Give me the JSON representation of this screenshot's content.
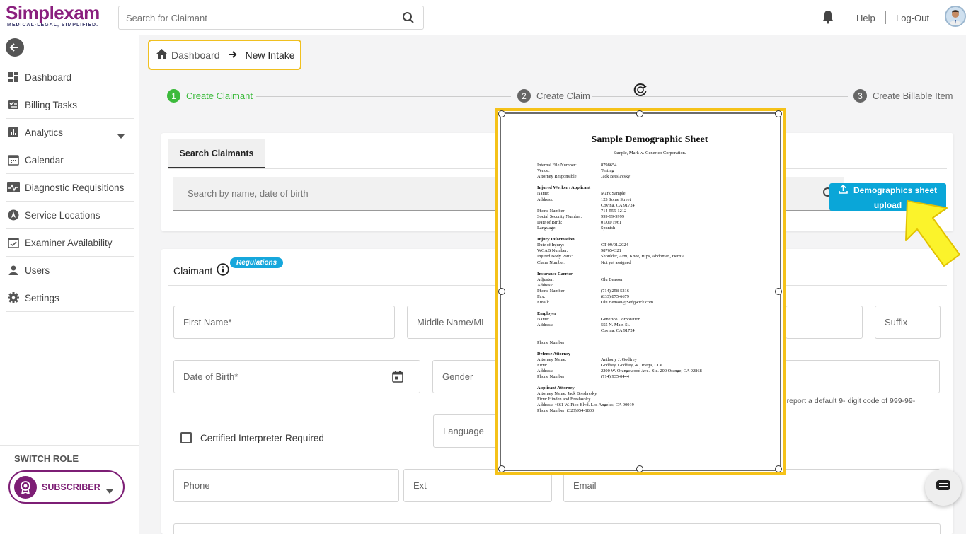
{
  "header": {
    "logo_main": "Simplexam",
    "logo_tagline": "MEDICAL-LEGAL, SIMPLIFIED.",
    "search_placeholder": "Search for Claimant",
    "help": "Help",
    "logout": "Log-Out"
  },
  "sidebar": {
    "items": [
      {
        "label": "Dashboard",
        "icon": "dashboard-icon"
      },
      {
        "label": "Billing Tasks",
        "icon": "billing-icon"
      },
      {
        "label": "Analytics",
        "icon": "analytics-icon"
      },
      {
        "label": "Calendar",
        "icon": "calendar-icon"
      },
      {
        "label": "Diagnostic Requisitions",
        "icon": "diagnostic-icon"
      },
      {
        "label": "Service Locations",
        "icon": "location-icon"
      },
      {
        "label": "Examiner Availability",
        "icon": "availability-icon"
      },
      {
        "label": "Users",
        "icon": "user-icon"
      },
      {
        "label": "Settings",
        "icon": "gear-icon"
      }
    ],
    "switch_role_label": "SWITCH ROLE",
    "role": "SUBSCRIBER"
  },
  "breadcrumb": {
    "home": "Dashboard",
    "current": "New Intake"
  },
  "stepper": {
    "steps": [
      {
        "num": "1",
        "label": "Create Claimant",
        "active": true
      },
      {
        "num": "2",
        "label": "Create Claim",
        "active": false
      },
      {
        "num": "3",
        "label": "Create Billable Item",
        "active": false
      }
    ]
  },
  "search_card": {
    "tab": "Search Claimants",
    "placeholder": "Search by name, date of birth",
    "upload_button_line1": "Demographics sheet",
    "upload_button_line2": "upload"
  },
  "claimant_card": {
    "title": "Claimant",
    "badge": "Regulations",
    "first_name": "First Name*",
    "middle_name": "Middle Name/MI",
    "suffix": "Suffix",
    "dob": "Date of Birth*",
    "gender": "Gender",
    "ssn_hint": "e, report a default 9- digit code of 999-99-",
    "interpreter": "Certified Interpreter Required",
    "language": "Language",
    "phone": "Phone",
    "ext": "Ext",
    "email": "Email"
  },
  "document": {
    "title": "Sample Demographic Sheet",
    "subtitle": "Sample, Mark .v. Generico Corporation.",
    "sections": [
      {
        "heading": "",
        "rows": [
          [
            "Internal File Number:",
            "8798654"
          ],
          [
            "Venue:",
            "Testing"
          ],
          [
            "Attorney Responsible:",
            "Jack Breslavsky"
          ]
        ]
      },
      {
        "heading": "Injured Worker / Applicant",
        "rows": [
          [
            "Name:",
            "Mark Sample"
          ],
          [
            "Address:",
            "123 Some Street"
          ],
          [
            "",
            "Covina, CA 91724"
          ],
          [
            "Phone Number:",
            "714-555-1212"
          ],
          [
            "Social Security Number:",
            "999-99-9999"
          ],
          [
            "Date of Birth:",
            "01/01/1961"
          ],
          [
            "Language:",
            "Spanish"
          ]
        ]
      },
      {
        "heading": "Injury Information",
        "rows": [
          [
            "Date of Injury:",
            "CT 09/01/2024"
          ],
          [
            "WCAB Number:",
            "987654321"
          ],
          [
            "Injured Body Parts:",
            "Shoulder, Arm, Knee, Hips, Abdomen, Hernia"
          ],
          [
            "Claim Number:",
            "Not yet assigned"
          ]
        ]
      },
      {
        "heading": "Insurance Carrier",
        "rows": [
          [
            "Adjuster:",
            "Olu Benson"
          ],
          [
            "Address:",
            ""
          ],
          [
            "Phone Number:",
            "(714) 258-5216"
          ],
          [
            "Fax:",
            "(833) 875-6679"
          ],
          [
            "Email:",
            "Olu.Benson@Sedgwick.com"
          ]
        ]
      },
      {
        "heading": "Employer",
        "rows": [
          [
            "Name:",
            "Generico Corporation"
          ],
          [
            "Address:",
            "555 N. Main St."
          ],
          [
            "",
            "Covina, CA 91724"
          ],
          [
            "",
            ""
          ],
          [
            "Phone Number:",
            ""
          ]
        ]
      },
      {
        "heading": "Defense Attorney",
        "rows": [
          [
            "Attorney Name:",
            "Anthony J. Godfrey"
          ],
          [
            "Firm:",
            "Godfrey, Godfrey,  & Ortega, LLP"
          ],
          [
            "Address:",
            "2200 W. Orangewood Ave., Ste. 200 Orange, CA 92868"
          ],
          [
            "Phone Number:",
            "(714) 935-0444"
          ]
        ]
      }
    ],
    "applicant_attorney_heading": "Applicant Attorney",
    "applicant_attorney_lines": [
      "Attorney Name: Jack Breslavsky",
      "Firm: Hinden and Breslavsky",
      "Address: 4661 W. Pico Blvd. Los Angeles, CA 90019",
      "Phone Number: (323)954-1800"
    ]
  },
  "colors": {
    "brand": "#8a1f7e",
    "accent_blue": "#0aa6d8",
    "step_active": "#3cba3c",
    "highlight_yellow": "#f5c219"
  }
}
